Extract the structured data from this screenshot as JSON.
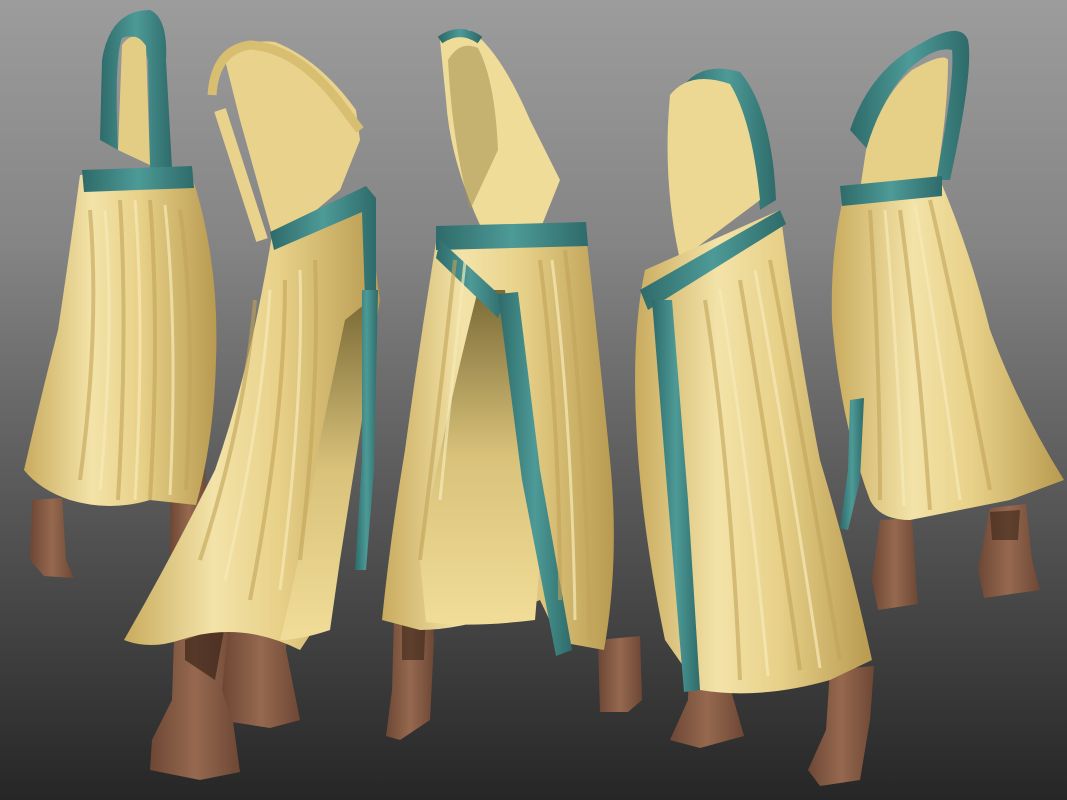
{
  "scene": {
    "colors": {
      "background_top": "#9c9c9c",
      "background_bottom": "#262626",
      "cloth": "#e9d38c",
      "cloth_shadow": "#c6a85a",
      "cloth_highlight": "#f6e8b4",
      "trim": "#3f8b8a",
      "trim_dark": "#2e6b6a",
      "boot": "#8a6048",
      "boot_dark": "#6d4735"
    },
    "figures": [
      {
        "view": "back-left",
        "name": "garment-view-1"
      },
      {
        "view": "left-side",
        "name": "garment-view-2"
      },
      {
        "view": "front",
        "name": "garment-view-3"
      },
      {
        "view": "right-side",
        "name": "garment-view-4"
      },
      {
        "view": "back-right",
        "name": "garment-view-5"
      }
    ]
  }
}
